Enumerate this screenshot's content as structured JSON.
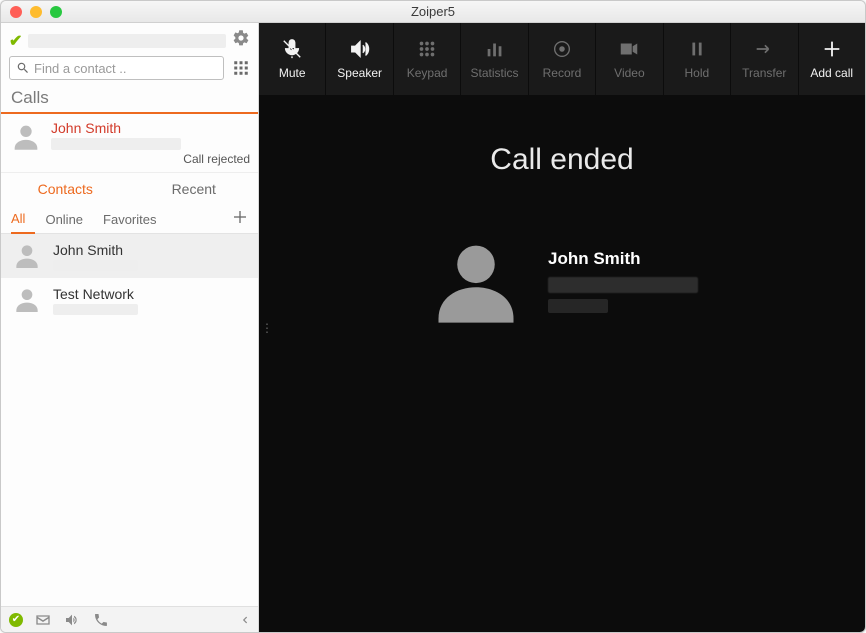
{
  "window": {
    "title": "Zoiper5"
  },
  "search": {
    "placeholder": "Find a contact .."
  },
  "sections": {
    "calls": "Calls"
  },
  "call": {
    "name": "John Smith",
    "status": "Call rejected"
  },
  "tabs": {
    "contacts": "Contacts",
    "recent": "Recent"
  },
  "subtabs": {
    "all": "All",
    "online": "Online",
    "favorites": "Favorites"
  },
  "contacts": [
    {
      "name": "John Smith"
    },
    {
      "name": "Test Network"
    }
  ],
  "toolbar": {
    "mute": "Mute",
    "speaker": "Speaker",
    "keypad": "Keypad",
    "statistics": "Statistics",
    "record": "Record",
    "video": "Video",
    "hold": "Hold",
    "transfer": "Transfer",
    "addcall": "Add call"
  },
  "main": {
    "status": "Call ended",
    "name": "John Smith"
  }
}
